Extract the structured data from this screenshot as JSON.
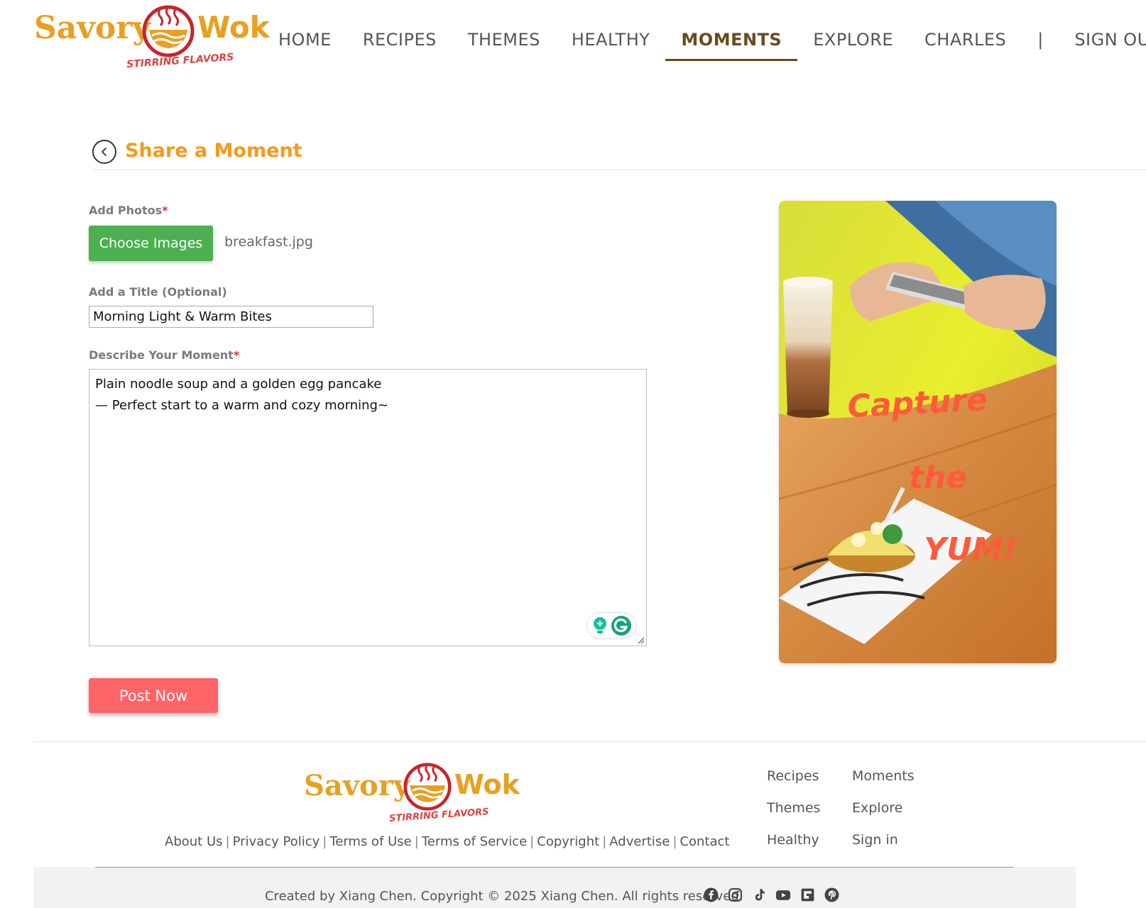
{
  "header": {
    "logo": {
      "word_left": "Savory",
      "word_right": "Wok",
      "tagline": "STIRRING FLAVORS"
    },
    "nav": [
      {
        "label": "HOME"
      },
      {
        "label": "RECIPES"
      },
      {
        "label": "THEMES"
      },
      {
        "label": "HEALTHY"
      },
      {
        "label": "MOMENTS",
        "active": true
      },
      {
        "label": "EXPLORE"
      },
      {
        "label": "CHARLES"
      },
      {
        "label": "SIGN OUT"
      }
    ],
    "separator": "|"
  },
  "page": {
    "title": "Share a Moment",
    "back_icon": "chevron-left-circle-icon"
  },
  "form": {
    "photos_label": "Add Photos",
    "required_mark": "*",
    "choose_button": "Choose Images",
    "file_name": "breakfast.jpg",
    "title_label": "Add a Title (Optional)",
    "title_value": "Morning Light & Warm Bites",
    "description_label": "Describe Your Moment",
    "description_value": "Plain noodle soup and a golden egg pancake\n— Perfect start to a warm and cozy morning~",
    "post_button": "Post Now"
  },
  "promo": {
    "line1": "Capture",
    "line2": "the",
    "line3": "YUM!"
  },
  "footer": {
    "links": [
      "About Us",
      "Privacy Policy",
      "Terms of Use",
      "Terms of Service",
      "Copyright",
      "Advertise",
      "Contact"
    ],
    "nav": [
      "Recipes",
      "Moments",
      "Themes",
      "Explore",
      "Healthy",
      "Sign in"
    ],
    "copyright": "Created by Xiang Chen. Copyright © 2025 Xiang Chen. All rights reserved.",
    "socials": [
      "facebook-icon",
      "instagram-icon",
      "tiktok-icon",
      "youtube-icon",
      "flipboard-icon",
      "pinterest-icon"
    ]
  },
  "colors": {
    "brand_orange": "#f59a1e",
    "nav_active": "#6b4a1e",
    "choose_green": "#4caf50",
    "post_red": "#ff6468",
    "required_red": "#d93535"
  }
}
